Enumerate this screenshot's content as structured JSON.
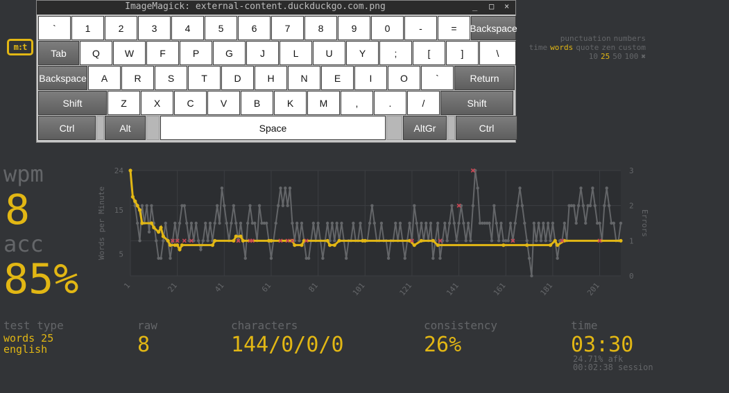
{
  "window": {
    "title": "ImageMagick: external-content.duckduckgo.com.png",
    "controls": [
      "_",
      "□",
      "×"
    ]
  },
  "logo": {
    "text": "m:t"
  },
  "config": {
    "row1": [
      "punctuation",
      "numbers"
    ],
    "row2": [
      "time",
      "words",
      "quote",
      "zen",
      "custom"
    ],
    "row2_active": "words",
    "row3": [
      "10",
      "25",
      "50",
      "100"
    ],
    "row3_active": "25",
    "wrench_icon": "wrench-icon"
  },
  "keyboard": {
    "rows": [
      [
        "`",
        "1",
        "2",
        "3",
        "4",
        "5",
        "6",
        "7",
        "8",
        "9",
        "0",
        "-",
        "=",
        "Backspace"
      ],
      [
        "Tab",
        "Q",
        "W",
        "F",
        "P",
        "G",
        "J",
        "L",
        "U",
        "Y",
        ";",
        "[",
        "]",
        "\\"
      ],
      [
        "Backspace",
        "A",
        "R",
        "S",
        "T",
        "D",
        "H",
        "N",
        "E",
        "I",
        "O",
        "`",
        "Return"
      ],
      [
        "Shift",
        "Z",
        "X",
        "C",
        "V",
        "B",
        "K",
        "M",
        ",",
        ".",
        "/",
        "Shift"
      ],
      [
        "Ctrl",
        "",
        "Alt",
        "",
        "Space",
        "",
        "AltGr",
        "",
        "Ctrl"
      ]
    ]
  },
  "stats": {
    "wpm_label": "wpm",
    "wpm": "8",
    "acc_label": "acc",
    "acc": "85%",
    "test_type_label": "test type",
    "test_type_1": "words 25",
    "test_type_2": "english",
    "raw_label": "raw",
    "raw": "8",
    "characters_label": "characters",
    "characters": "144/0/0/0",
    "consistency_label": "consistency",
    "consistency": "26%",
    "time_label": "time",
    "time": "03:30",
    "afk": "24.71% afk",
    "session": "00:02:38 session"
  },
  "colors": {
    "accent": "#e2b714",
    "sub": "#646669",
    "bg": "#323437",
    "error": "#ca4754"
  },
  "chart_data": {
    "type": "line",
    "ylabel": "Words per Minute",
    "y2label": "Errors",
    "ylim": [
      0,
      24
    ],
    "y_ticks": [
      "5",
      "15",
      "24"
    ],
    "y2lim": [
      0,
      3
    ],
    "y2_ticks": [
      "0",
      "1",
      "2",
      "3"
    ],
    "x_ticks": [
      "1",
      "21",
      "41",
      "61",
      "81",
      "101",
      "121",
      "141",
      "161",
      "181",
      "201"
    ],
    "x_range": [
      1,
      210
    ],
    "series": [
      {
        "name": "wpm",
        "color": "#e2b714",
        "points": [
          [
            1,
            24
          ],
          [
            2,
            18
          ],
          [
            3,
            17
          ],
          [
            4,
            16
          ],
          [
            5,
            15
          ],
          [
            6,
            12
          ],
          [
            10,
            12
          ],
          [
            11,
            11
          ],
          [
            13,
            10
          ],
          [
            14,
            11
          ],
          [
            15,
            9
          ],
          [
            17,
            8
          ],
          [
            18,
            7
          ],
          [
            20,
            7
          ],
          [
            21,
            7
          ],
          [
            22,
            6
          ],
          [
            23,
            7
          ],
          [
            36,
            7
          ],
          [
            37,
            8
          ],
          [
            45,
            8
          ],
          [
            46,
            9
          ],
          [
            48,
            9
          ],
          [
            49,
            8
          ],
          [
            60,
            8
          ],
          [
            61,
            8
          ],
          [
            70,
            8
          ],
          [
            71,
            7
          ],
          [
            74,
            7
          ],
          [
            75,
            8
          ],
          [
            85,
            8
          ],
          [
            86,
            7
          ],
          [
            88,
            7
          ],
          [
            90,
            8
          ],
          [
            100,
            8
          ],
          [
            101,
            8
          ],
          [
            120,
            8
          ],
          [
            122,
            7
          ],
          [
            125,
            8
          ],
          [
            130,
            8
          ],
          [
            132,
            7
          ],
          [
            160,
            7
          ],
          [
            170,
            7
          ],
          [
            180,
            7
          ],
          [
            182,
            8
          ],
          [
            183,
            7
          ],
          [
            186,
            8
          ],
          [
            210,
            8
          ]
        ]
      },
      {
        "name": "raw",
        "color": "#646669",
        "points": [
          [
            1,
            24
          ],
          [
            2,
            18
          ],
          [
            3,
            16
          ],
          [
            4,
            12
          ],
          [
            5,
            8
          ],
          [
            6,
            16
          ],
          [
            7,
            12
          ],
          [
            8,
            16
          ],
          [
            9,
            10
          ],
          [
            10,
            16
          ],
          [
            11,
            12
          ],
          [
            12,
            8
          ],
          [
            13,
            4
          ],
          [
            14,
            4
          ],
          [
            15,
            8
          ],
          [
            16,
            12
          ],
          [
            17,
            8
          ],
          [
            18,
            4
          ],
          [
            19,
            8
          ],
          [
            20,
            12
          ],
          [
            21,
            8
          ],
          [
            22,
            12
          ],
          [
            23,
            16
          ],
          [
            24,
            16
          ],
          [
            25,
            12
          ],
          [
            26,
            8
          ],
          [
            27,
            12
          ],
          [
            28,
            8
          ],
          [
            29,
            12
          ],
          [
            30,
            8
          ],
          [
            31,
            6
          ],
          [
            32,
            8
          ],
          [
            33,
            12
          ],
          [
            34,
            8
          ],
          [
            35,
            12
          ],
          [
            36,
            8
          ],
          [
            37,
            12
          ],
          [
            38,
            16
          ],
          [
            39,
            12
          ],
          [
            40,
            20
          ],
          [
            41,
            16
          ],
          [
            42,
            12
          ],
          [
            43,
            8
          ],
          [
            44,
            12
          ],
          [
            45,
            16
          ],
          [
            46,
            12
          ],
          [
            47,
            8
          ],
          [
            48,
            12
          ],
          [
            49,
            8
          ],
          [
            50,
            4
          ],
          [
            51,
            12
          ],
          [
            52,
            16
          ],
          [
            53,
            12
          ],
          [
            54,
            12
          ],
          [
            55,
            8
          ],
          [
            56,
            16
          ],
          [
            57,
            12
          ],
          [
            58,
            12
          ],
          [
            59,
            12
          ],
          [
            60,
            8
          ],
          [
            61,
            4
          ],
          [
            62,
            8
          ],
          [
            63,
            12
          ],
          [
            64,
            16
          ],
          [
            65,
            20
          ],
          [
            66,
            16
          ],
          [
            67,
            20
          ],
          [
            68,
            16
          ],
          [
            69,
            20
          ],
          [
            70,
            12
          ],
          [
            71,
            8
          ],
          [
            72,
            12
          ],
          [
            73,
            8
          ],
          [
            74,
            12
          ],
          [
            75,
            8
          ],
          [
            76,
            4
          ],
          [
            77,
            4
          ],
          [
            78,
            8
          ],
          [
            79,
            12
          ],
          [
            80,
            8
          ],
          [
            81,
            12
          ],
          [
            82,
            8
          ],
          [
            83,
            4
          ],
          [
            84,
            8
          ],
          [
            85,
            12
          ],
          [
            86,
            8
          ],
          [
            87,
            12
          ],
          [
            88,
            8
          ],
          [
            89,
            12
          ],
          [
            90,
            8
          ],
          [
            91,
            12
          ],
          [
            92,
            8
          ],
          [
            93,
            4
          ],
          [
            94,
            8
          ],
          [
            95,
            8
          ],
          [
            96,
            12
          ],
          [
            97,
            8
          ],
          [
            98,
            8
          ],
          [
            99,
            12
          ],
          [
            100,
            8
          ],
          [
            101,
            8
          ],
          [
            102,
            8
          ],
          [
            103,
            12
          ],
          [
            104,
            16
          ],
          [
            105,
            12
          ],
          [
            106,
            8
          ],
          [
            107,
            8
          ],
          [
            108,
            12
          ],
          [
            109,
            8
          ],
          [
            110,
            8
          ],
          [
            111,
            4
          ],
          [
            112,
            8
          ],
          [
            113,
            8
          ],
          [
            114,
            12
          ],
          [
            115,
            8
          ],
          [
            116,
            12
          ],
          [
            117,
            8
          ],
          [
            118,
            4
          ],
          [
            119,
            8
          ],
          [
            120,
            12
          ],
          [
            121,
            8
          ],
          [
            122,
            16
          ],
          [
            123,
            12
          ],
          [
            124,
            8
          ],
          [
            125,
            12
          ],
          [
            126,
            8
          ],
          [
            127,
            12
          ],
          [
            128,
            8
          ],
          [
            129,
            12
          ],
          [
            130,
            4
          ],
          [
            131,
            8
          ],
          [
            132,
            12
          ],
          [
            133,
            4
          ],
          [
            134,
            8
          ],
          [
            135,
            12
          ],
          [
            136,
            8
          ],
          [
            137,
            12
          ],
          [
            138,
            16
          ],
          [
            139,
            12
          ],
          [
            140,
            8
          ],
          [
            141,
            12
          ],
          [
            142,
            16
          ],
          [
            143,
            12
          ],
          [
            144,
            8
          ],
          [
            145,
            12
          ],
          [
            146,
            8
          ],
          [
            147,
            16
          ],
          [
            148,
            24
          ],
          [
            149,
            20
          ],
          [
            150,
            12
          ],
          [
            151,
            12
          ],
          [
            152,
            12
          ],
          [
            153,
            12
          ],
          [
            154,
            12
          ],
          [
            155,
            8
          ],
          [
            156,
            16
          ],
          [
            157,
            12
          ],
          [
            158,
            8
          ],
          [
            159,
            12
          ],
          [
            160,
            8
          ],
          [
            161,
            8
          ],
          [
            162,
            8
          ],
          [
            163,
            12
          ],
          [
            164,
            8
          ],
          [
            165,
            12
          ],
          [
            166,
            16
          ],
          [
            167,
            20
          ],
          [
            168,
            16
          ],
          [
            169,
            12
          ],
          [
            170,
            8
          ],
          [
            171,
            4
          ],
          [
            172,
            0
          ],
          [
            173,
            12
          ],
          [
            174,
            8
          ],
          [
            175,
            12
          ],
          [
            176,
            8
          ],
          [
            177,
            12
          ],
          [
            178,
            8
          ],
          [
            179,
            12
          ],
          [
            180,
            8
          ],
          [
            181,
            12
          ],
          [
            182,
            8
          ],
          [
            183,
            4
          ],
          [
            184,
            8
          ],
          [
            185,
            8
          ],
          [
            186,
            12
          ],
          [
            187,
            8
          ],
          [
            188,
            16
          ],
          [
            189,
            16
          ],
          [
            190,
            16
          ],
          [
            191,
            12
          ],
          [
            192,
            16
          ],
          [
            193,
            20
          ],
          [
            194,
            16
          ],
          [
            195,
            12
          ],
          [
            196,
            16
          ],
          [
            197,
            16
          ],
          [
            198,
            20
          ],
          [
            199,
            16
          ],
          [
            200,
            12
          ],
          [
            201,
            12
          ],
          [
            202,
            8
          ],
          [
            203,
            16
          ],
          [
            204,
            20
          ],
          [
            205,
            16
          ],
          [
            206,
            12
          ],
          [
            207,
            12
          ],
          [
            208,
            8
          ],
          [
            209,
            8
          ],
          [
            210,
            12
          ]
        ]
      },
      {
        "name": "errors",
        "color": "#ca4754",
        "points": [
          [
            19,
            1
          ],
          [
            21,
            1
          ],
          [
            24,
            1
          ],
          [
            27,
            1
          ],
          [
            47,
            1
          ],
          [
            52,
            1
          ],
          [
            53,
            1
          ],
          [
            65,
            1
          ],
          [
            68,
            1
          ],
          [
            70,
            1
          ],
          [
            76,
            1
          ],
          [
            121,
            1
          ],
          [
            133,
            1
          ],
          [
            141,
            2
          ],
          [
            147,
            3
          ],
          [
            164,
            1
          ],
          [
            185,
            1
          ],
          [
            201,
            1
          ]
        ]
      }
    ]
  }
}
